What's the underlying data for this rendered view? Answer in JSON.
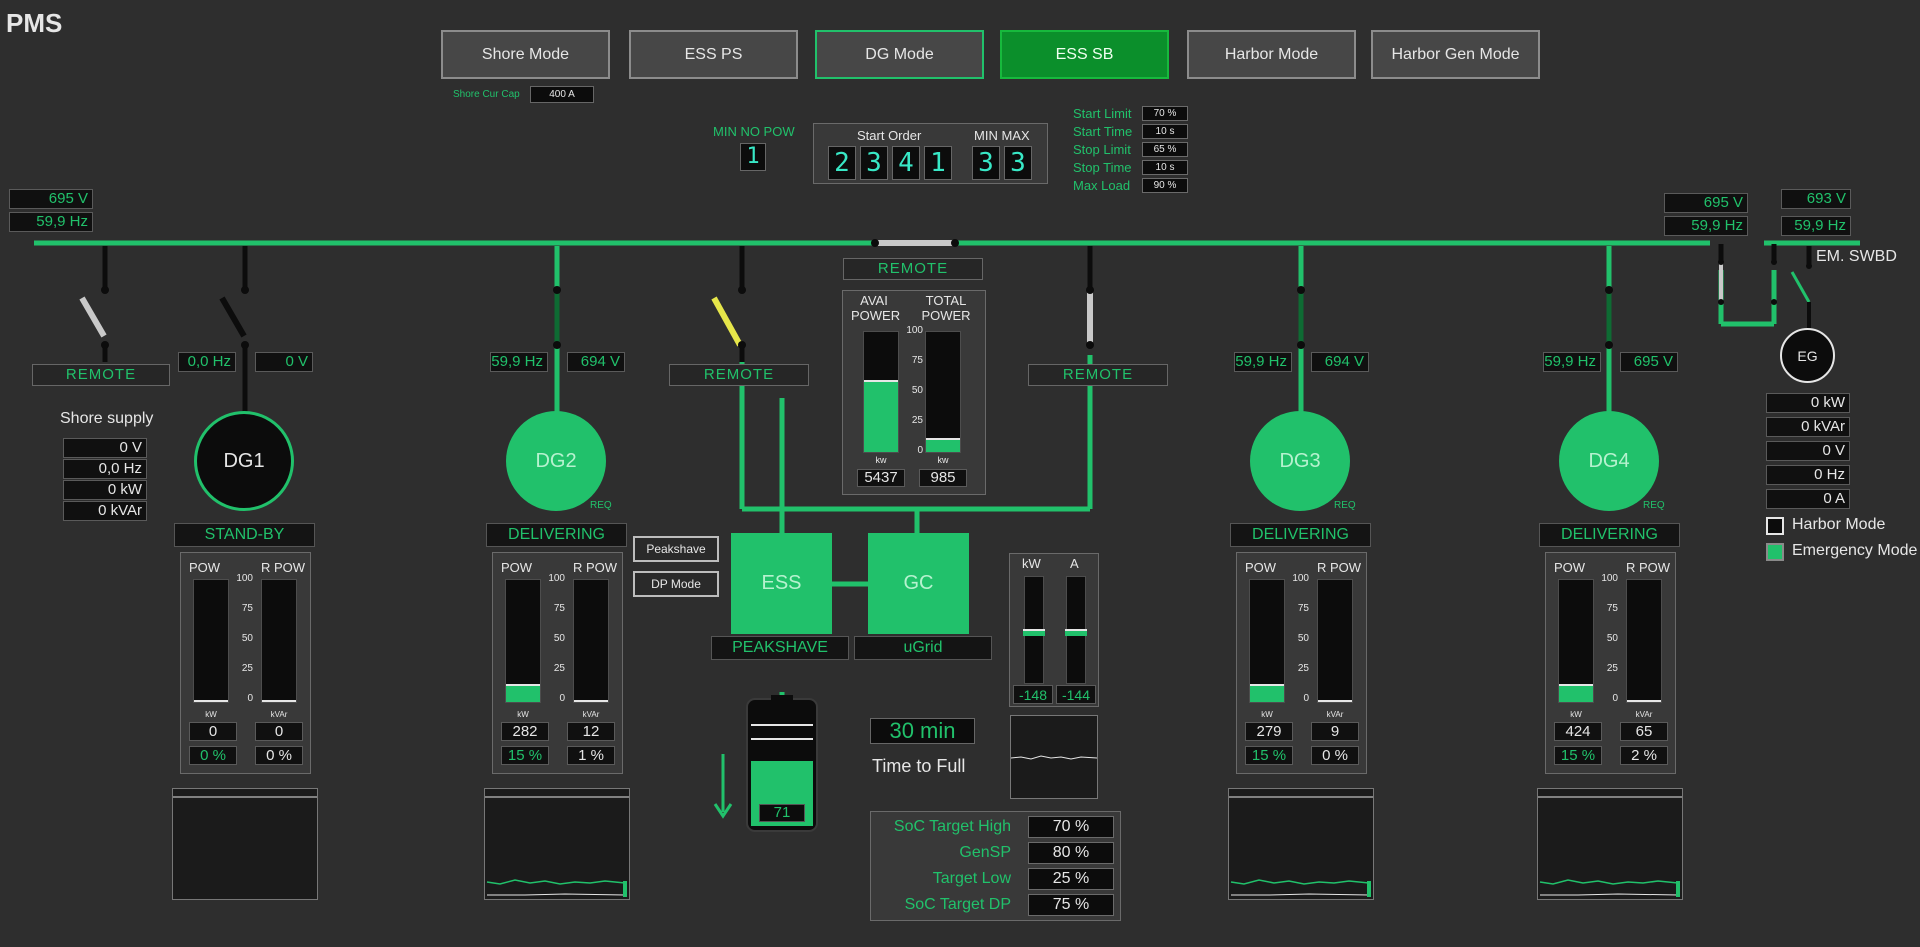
{
  "app": {
    "title": "PMS"
  },
  "modes": [
    {
      "label": "Shore Mode",
      "state": "normal"
    },
    {
      "label": "ESS PS",
      "state": "normal"
    },
    {
      "label": "DG Mode",
      "state": "outline"
    },
    {
      "label": "ESS SB",
      "state": "active"
    },
    {
      "label": "Harbor Mode",
      "state": "normal"
    },
    {
      "label": "Harbor Gen Mode",
      "state": "normal"
    }
  ],
  "shore_cap": {
    "label": "Shore Cur Cap",
    "value": "400 A"
  },
  "min_no_pow": {
    "label": "MIN NO POW",
    "value": "1"
  },
  "start_order": {
    "label": "Start Order",
    "digits": [
      "2",
      "3",
      "4",
      "1"
    ],
    "minmax_label": "MIN MAX",
    "minmax": [
      "3",
      "3"
    ]
  },
  "limits": [
    {
      "label": "Start Limit",
      "value": "70 %"
    },
    {
      "label": "Start Time",
      "value": "10 s"
    },
    {
      "label": "Stop Limit",
      "value": "65 %"
    },
    {
      "label": "Stop Time",
      "value": "10 s"
    },
    {
      "label": "Max Load",
      "value": "90 %"
    }
  ],
  "bus": {
    "left": {
      "voltage": "695 V",
      "freq": "59,9 Hz"
    },
    "right": {
      "voltage": "695 V",
      "freq": "59,9 Hz"
    },
    "em": {
      "voltage": "693 V",
      "freq": "59,9 Hz",
      "label": "EM. SWBD"
    }
  },
  "remote_label": "REMOTE",
  "shore": {
    "title": "Shore supply",
    "values": [
      "0 V",
      "0,0 Hz",
      "0 kW",
      "0 kVAr"
    ]
  },
  "chart_units": {
    "kw": "kW",
    "kvar": "kVAr",
    "ticks": [
      "100",
      "75",
      "50",
      "25",
      "0"
    ],
    "pow": "POW",
    "rpow": "R POW"
  },
  "gens": [
    {
      "name": "DG1",
      "freq": "0,0 Hz",
      "volt": "0 V",
      "state": "STAND-BY",
      "kw": "0",
      "kvar": "0",
      "kw_pct": "0 %",
      "kvar_pct": "0 %",
      "pow_level": 0,
      "rpow_level": 0,
      "running": false,
      "req": ""
    },
    {
      "name": "DG2",
      "freq": "59,9 Hz",
      "volt": "694 V",
      "state": "DELIVERING",
      "kw": "282",
      "kvar": "12",
      "kw_pct": "15 %",
      "kvar_pct": "1 %",
      "pow_level": 15,
      "rpow_level": 1,
      "running": true,
      "req": "REQ"
    },
    {
      "name": "DG3",
      "freq": "59,9 Hz",
      "volt": "694 V",
      "state": "DELIVERING",
      "kw": "279",
      "kvar": "9",
      "kw_pct": "15 %",
      "kvar_pct": "0 %",
      "pow_level": 15,
      "rpow_level": 0,
      "running": true,
      "req": "REQ"
    },
    {
      "name": "DG4",
      "freq": "59,9 Hz",
      "volt": "695 V",
      "state": "DELIVERING",
      "kw": "424",
      "kvar": "65",
      "kw_pct": "15 %",
      "kvar_pct": "2 %",
      "pow_level": 15,
      "rpow_level": 2,
      "running": true,
      "req": "REQ"
    }
  ],
  "power_panel": {
    "avai_label": "AVAI POWER",
    "total_label": "TOTAL POWER",
    "avai_value": "5437",
    "total_value": "985",
    "unit": "kw",
    "ticks": [
      "100",
      "75",
      "50",
      "25",
      "0"
    ],
    "avai_level": 60,
    "total_level": 12
  },
  "ess": {
    "label": "ESS",
    "gc_label": "GC",
    "mode": "PEAKSHAVE",
    "gc_mode": "uGrid",
    "btn_peakshave": "Peakshave",
    "btn_dp": "DP Mode",
    "soc": "71",
    "soc_level": 71,
    "kw_label": "kW",
    "a_label": "A",
    "kw_value": "-148",
    "a_value": "-144",
    "time_value": "30 min",
    "time_label": "Time to Full",
    "targets": [
      {
        "label": "SoC Target High",
        "value": "70 %"
      },
      {
        "label": "GenSP",
        "value": "80 %"
      },
      {
        "label": "Target Low",
        "value": "25 %"
      },
      {
        "label": "SoC Target DP",
        "value": "75 %"
      }
    ]
  },
  "eg": {
    "label": "EG",
    "values": [
      "0 kW",
      "0 kVAr",
      "0 V",
      "0 Hz",
      "0 A"
    ]
  },
  "options": [
    {
      "label": "Harbor Mode",
      "checked": false
    },
    {
      "label": "Emergency Mode",
      "checked": true
    }
  ]
}
